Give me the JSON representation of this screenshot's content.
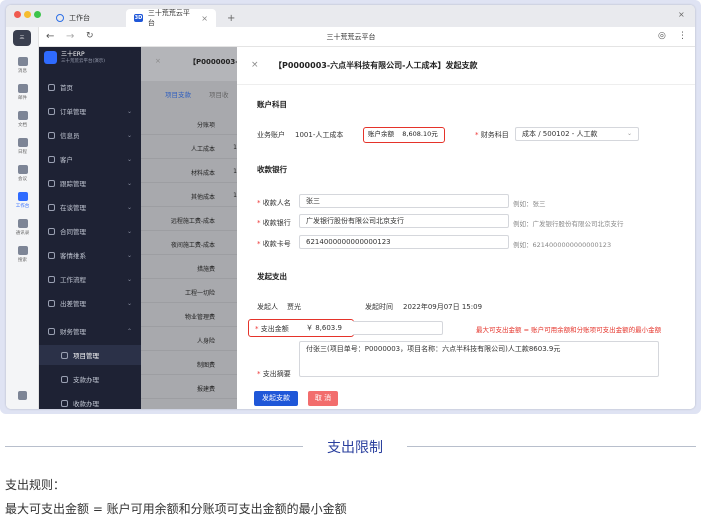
{
  "tabs": [
    {
      "label": "工作台"
    },
    {
      "label": "三十荒荒云平台"
    }
  ],
  "window_title": "三十荒荒云平台",
  "rail": [
    {
      "label": "消息"
    },
    {
      "label": "邮件"
    },
    {
      "label": "文档"
    },
    {
      "label": "日程"
    },
    {
      "label": "会议"
    },
    {
      "label": "工作台"
    },
    {
      "label": "通讯录"
    },
    {
      "label": "搜索"
    }
  ],
  "brand": {
    "line1": "三十ERP",
    "line2": "三十荒荒云平台(演示)"
  },
  "sidebar": [
    {
      "label": "首页"
    },
    {
      "label": "订单管理"
    },
    {
      "label": "信息员"
    },
    {
      "label": "客户"
    },
    {
      "label": "跟踪管理"
    },
    {
      "label": "在谈管理"
    },
    {
      "label": "合同管理"
    },
    {
      "label": "客情维系"
    },
    {
      "label": "工作流程"
    },
    {
      "label": "出差管理"
    },
    {
      "label": "财务管理"
    },
    {
      "label": "项目管理"
    },
    {
      "label": "支款办理"
    },
    {
      "label": "收款办理"
    }
  ],
  "main": {
    "code": "【P0000003-",
    "tab1": "项目支款",
    "tab2": "项目收",
    "rows": [
      {
        "label": "分账项",
        "value": ""
      },
      {
        "label": "人工成本",
        "value": "1"
      },
      {
        "label": "材料成本",
        "value": "1"
      },
      {
        "label": "其他成本",
        "value": "1"
      },
      {
        "label": "远程施工费-成本",
        "value": ""
      },
      {
        "label": "夜间施工费-成本",
        "value": ""
      },
      {
        "label": "措施费",
        "value": ""
      },
      {
        "label": "工程一切险",
        "value": ""
      },
      {
        "label": "物业管理费",
        "value": ""
      },
      {
        "label": "人身险",
        "value": ""
      },
      {
        "label": "制图费",
        "value": ""
      },
      {
        "label": "报建费",
        "value": ""
      }
    ]
  },
  "drawer": {
    "close": "×",
    "title": "【P0000003-六点半科技有限公司-人工成本】发起支款",
    "account": {
      "section": "账户科目",
      "biz_label": "业务账户",
      "biz_value": "1001-人工成本",
      "balance_label": "账户余额",
      "balance_value": "8,608.10元",
      "subject_label": "财务科目",
      "subject_value": "成本 / 500102 - 人工款"
    },
    "bank": {
      "section": "收款银行",
      "name_label": "收款人名",
      "name_value": "张三",
      "name_hint": "例如：张三",
      "bank_label": "收款银行",
      "bank_value": "广发银行股份有限公司北京支行",
      "bank_hint": "例如：广发银行股份有限公司北京支行",
      "card_label": "收款卡号",
      "card_value": "6214000000000000123",
      "card_hint": "例如：6214000000000000123"
    },
    "pay": {
      "section": "发起支出",
      "initiator_label": "发起人",
      "initiator_value": "贾光",
      "time_label": "发起时间",
      "time_value": "2022年09月07日 15:09",
      "amount_label": "支出金额",
      "amount_value": "￥ 8,603.9",
      "note": "最大可支出金额 = 账户可用余额和分账项可支出金额的最小金额",
      "memo_label": "支出摘要",
      "memo_value": "付张三(项目单号：P0000003，项目名称：六点半科技有限公司)人工款8603.9元"
    },
    "submit": "发起支款",
    "cancel": "取 消"
  },
  "caption": "支出限制",
  "rule_title": "支出规则：",
  "rule_text": "最大可支出金额 = 账户可用余额和分账项可支出金额的最小金额",
  "colors": {
    "primary": "#1f57d8",
    "danger": "#e5332a",
    "sidebar": "#1e2234",
    "caption": "#2a3f9e"
  }
}
